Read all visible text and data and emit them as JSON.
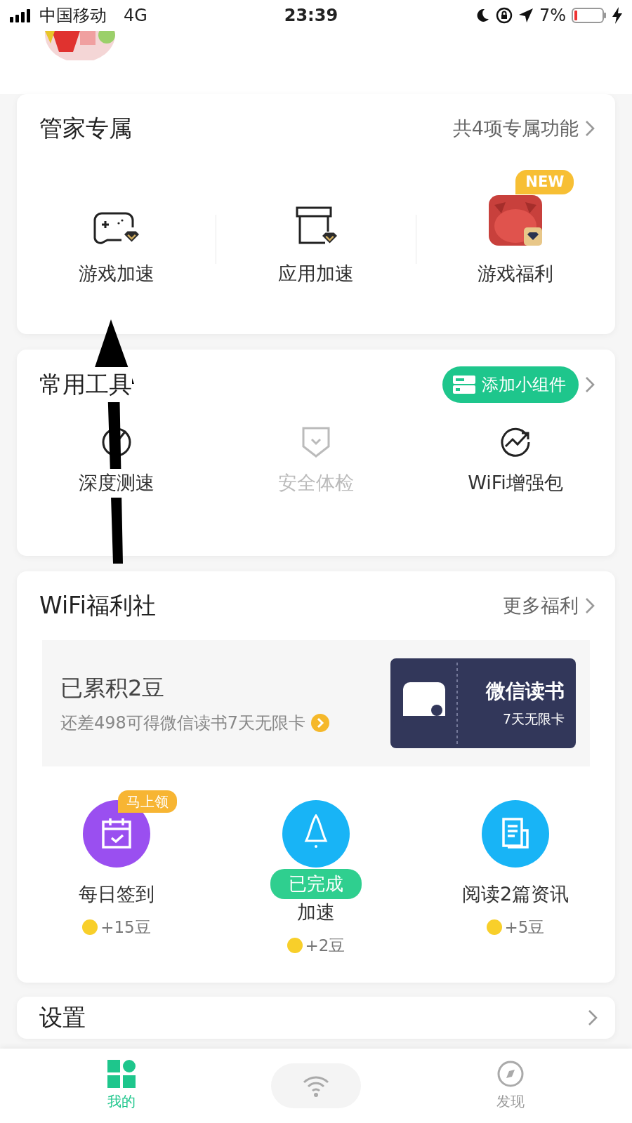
{
  "status_bar": {
    "carrier": "中国移动",
    "network": "4G",
    "time": "23:39",
    "battery": "7%"
  },
  "exclusive": {
    "title": "管家专属",
    "link": "共4项专属功能",
    "items": [
      {
        "label": "游戏加速",
        "kind": "gamepad"
      },
      {
        "label": "应用加速",
        "kind": "box"
      },
      {
        "label": "游戏福利",
        "kind": "app",
        "badge": "NEW"
      }
    ]
  },
  "tools": {
    "title": "常用工具",
    "widget_button": "添加小组件",
    "items": [
      {
        "label": "深度测速",
        "kind": "gauge",
        "disabled": false
      },
      {
        "label": "安全体检",
        "kind": "shield",
        "disabled": true
      },
      {
        "label": "WiFi增强包",
        "kind": "trend",
        "disabled": false
      }
    ]
  },
  "welfare": {
    "title": "WiFi福利社",
    "link": "更多福利",
    "progress": {
      "title": "已累积2豆",
      "subtitle": "还差498可得微信读书7天无限卡"
    },
    "ticket": {
      "title": "微信读书",
      "subtitle": "7天无限卡"
    },
    "tasks": [
      {
        "label": "每日签到",
        "reward": "+15豆",
        "kind": "calendar",
        "color": "#9a4ff0",
        "badge": {
          "text": "马上领",
          "kind": "claim"
        }
      },
      {
        "label": "加速",
        "reward": "+2豆",
        "kind": "rocket",
        "color": "#18b4f6",
        "badge": {
          "text": "已完成",
          "kind": "done"
        }
      },
      {
        "label": "阅读2篇资讯",
        "reward": "+5豆",
        "kind": "article",
        "color": "#18b4f6"
      }
    ]
  },
  "settings": {
    "title": "设置"
  },
  "nav": [
    {
      "label": "我的",
      "kind": "home",
      "selected": true
    },
    {
      "kind": "wifi",
      "selected": false
    },
    {
      "label": "发现",
      "kind": "discover",
      "selected": false
    }
  ]
}
